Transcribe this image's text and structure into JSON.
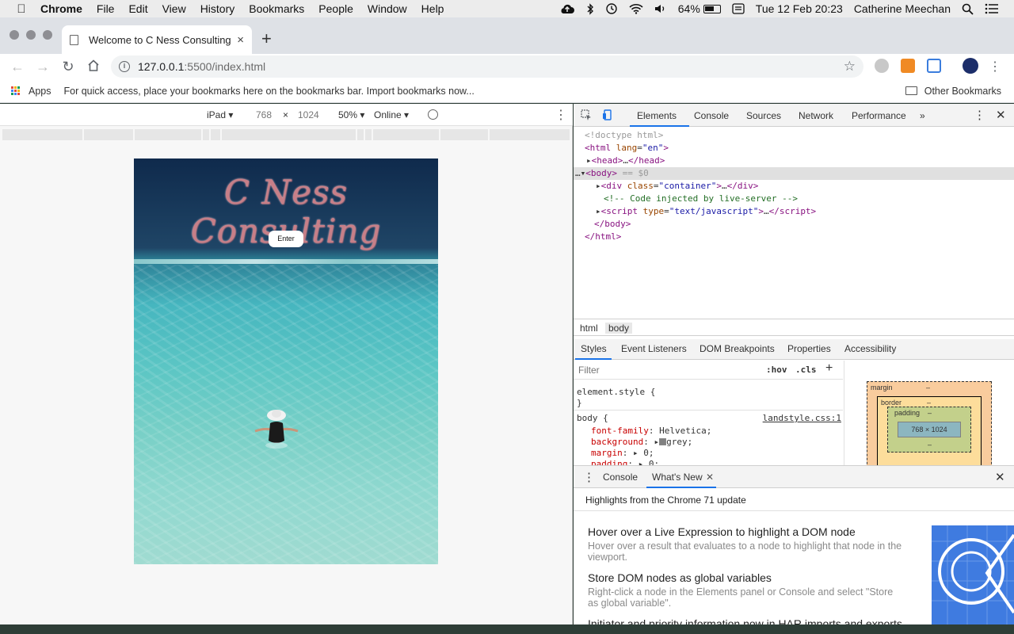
{
  "menubar": {
    "app": "Chrome",
    "items": [
      "File",
      "Edit",
      "View",
      "History",
      "Bookmarks",
      "People",
      "Window",
      "Help"
    ],
    "battery": "64%",
    "datetime": "Tue 12 Feb  20:23",
    "user": "Catherine Meechan"
  },
  "tab": {
    "title": "Welcome to C Ness Consulting",
    "close": "×",
    "new": "+"
  },
  "toolbar": {
    "url_host": "127.0.0.1",
    "url_path": ":5500/index.html"
  },
  "bookmarks": {
    "apps": "Apps",
    "message": "For quick access, place your bookmarks here on the bookmarks bar. Import bookmarks now...",
    "other": "Other Bookmarks"
  },
  "device_toolbar": {
    "device": "iPad",
    "width": "768",
    "times": "×",
    "height": "1024",
    "zoom": "50%",
    "throttle": "Online"
  },
  "site": {
    "brand": "C Ness Consulting",
    "button": "Enter"
  },
  "devtools": {
    "tabs": [
      "Elements",
      "Console",
      "Sources",
      "Network",
      "Performance"
    ],
    "more": "»",
    "dom": {
      "doctype": "<!doctype html>",
      "html_open_tag": "html",
      "html_attr": "lang",
      "html_attr_val": "\"en\"",
      "head": "head",
      "body": "body",
      "body_eq": "== $0",
      "div_attr": "class",
      "div_val": "\"container\"",
      "comment": "<!-- Code injected by live-server -->",
      "script_attr": "type",
      "script_val": "\"text/javascript\""
    },
    "breadcrumbs": [
      "html",
      "body"
    ],
    "subtabs": [
      "Styles",
      "Event Listeners",
      "DOM Breakpoints",
      "Properties",
      "Accessibility"
    ],
    "styles": {
      "filter_placeholder": "Filter",
      "hov": ":hov",
      "cls": ".cls",
      "element_style": "element.style {",
      "close_brace": "}",
      "body_selector": "body {",
      "source": "landstyle.css:1",
      "rules": [
        {
          "prop": "font-family",
          "value": "Helvetica;"
        },
        {
          "prop": "background",
          "value": "grey;"
        },
        {
          "prop": "margin",
          "value": "0;"
        },
        {
          "prop": "padding",
          "value": "0;"
        }
      ]
    },
    "box_model": {
      "margin": "margin",
      "border": "border",
      "padding": "padding",
      "content": "768 × 1024",
      "dash": "–"
    },
    "drawer": {
      "tabs": [
        "Console",
        "What's New"
      ],
      "highlights": "Highlights from the Chrome 71 update",
      "items": [
        {
          "title": "Hover over a Live Expression to highlight a DOM node",
          "desc": "Hover over a result that evaluates to a node to highlight that node in the viewport."
        },
        {
          "title": "Store DOM nodes as global variables",
          "desc": "Right-click a node in the Elements panel or Console and select \"Store as global variable\"."
        },
        {
          "title": "Initiator and priority information now in HAR imports and exports",
          "desc": ""
        }
      ]
    }
  }
}
